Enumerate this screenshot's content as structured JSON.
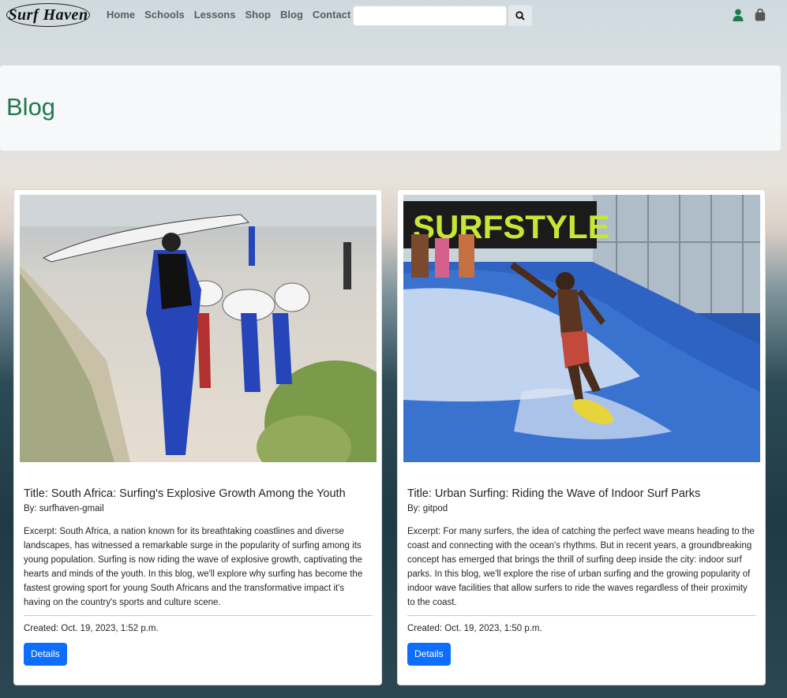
{
  "brand": {
    "logo_text": "Surf Haven"
  },
  "nav": {
    "items": [
      {
        "label": "Home"
      },
      {
        "label": "Schools"
      },
      {
        "label": "Lessons"
      },
      {
        "label": "Shop"
      },
      {
        "label": "Blog"
      },
      {
        "label": "Contact"
      }
    ]
  },
  "search": {
    "placeholder": "",
    "value": ""
  },
  "colors": {
    "accent": "#1f7a4c",
    "button": "#0d6efd",
    "nav_text": "#585d63"
  },
  "page": {
    "title": "Blog"
  },
  "posts": [
    {
      "image": "surf-students-carrying-boards-on-beach",
      "title": "Title: South Africa: Surfing's Explosive Growth Among the Youth",
      "author": "By: surfhaven-gmail",
      "excerpt": "Excerpt: South Africa, a nation known for its breathtaking coastlines and diverse landscapes, has witnessed a remarkable surge in the popularity of surfing among its young population. Surfing is now riding the wave of explosive growth, captivating the hearts and minds of the youth. In this blog, we'll explore why surfing has become the fastest growing sport for young South Africans and the transformative impact it's having on the country's sports and culture scene.",
      "created": "Created: Oct. 19, 2023, 1:52 p.m.",
      "button": "Details"
    },
    {
      "image": "indoor-surf-park-flowrider",
      "title": "Title: Urban Surfing: Riding the Wave of Indoor Surf Parks",
      "author": "By: gitpod",
      "excerpt": "Excerpt: For many surfers, the idea of catching the perfect wave means heading to the coast and connecting with the ocean's rhythms. But in recent years, a groundbreaking concept has emerged that brings the thrill of surfing deep inside the city: indoor surf parks. In this blog, we'll explore the rise of urban surfing and the growing popularity of indoor wave facilities that allow surfers to ride the waves regardless of their proximity to the coast.",
      "created": "Created: Oct. 19, 2023, 1:50 p.m.",
      "button": "Details"
    }
  ]
}
